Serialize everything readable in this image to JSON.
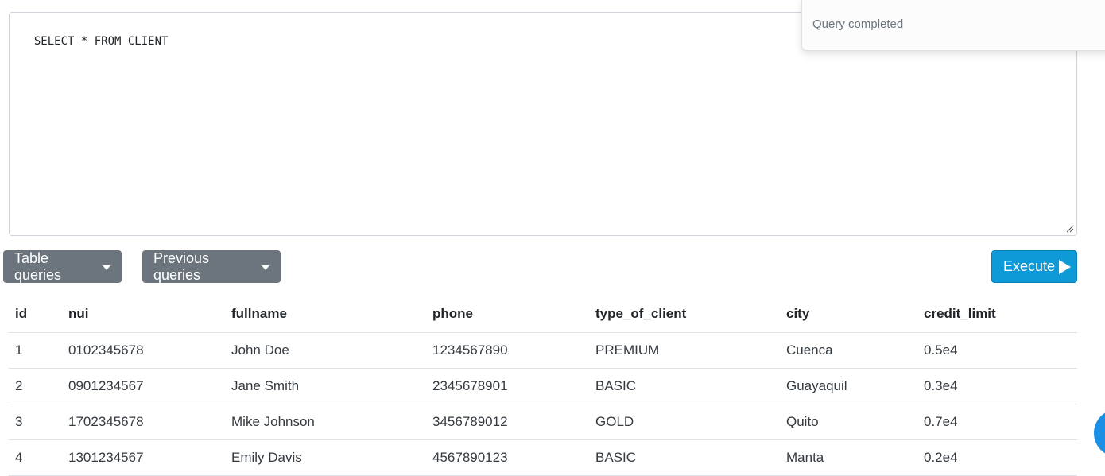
{
  "editor": {
    "query": "SELECT * FROM CLIENT"
  },
  "toast": {
    "message": "Query completed"
  },
  "toolbar": {
    "table_queries_label": "Table queries",
    "previous_queries_label": "Previous queries",
    "execute_label": "Execute"
  },
  "results": {
    "columns": [
      "id",
      "nui",
      "fullname",
      "phone",
      "type_of_client",
      "city",
      "credit_limit"
    ],
    "rows": [
      [
        "1",
        "0102345678",
        "John Doe",
        "1234567890",
        "PREMIUM",
        "Cuenca",
        "0.5e4"
      ],
      [
        "2",
        "0901234567",
        "Jane Smith",
        "2345678901",
        "BASIC",
        "Guayaquil",
        "0.3e4"
      ],
      [
        "3",
        "1702345678",
        "Mike Johnson",
        "3456789012",
        "GOLD",
        "Quito",
        "0.7e4"
      ],
      [
        "4",
        "1301234567",
        "Emily Davis",
        "4567890123",
        "BASIC",
        "Manta",
        "0.2e4"
      ]
    ]
  },
  "colors": {
    "secondary_button": "#6c757d",
    "primary_button": "#0d9ad6",
    "fab": "#1a8fe3"
  }
}
